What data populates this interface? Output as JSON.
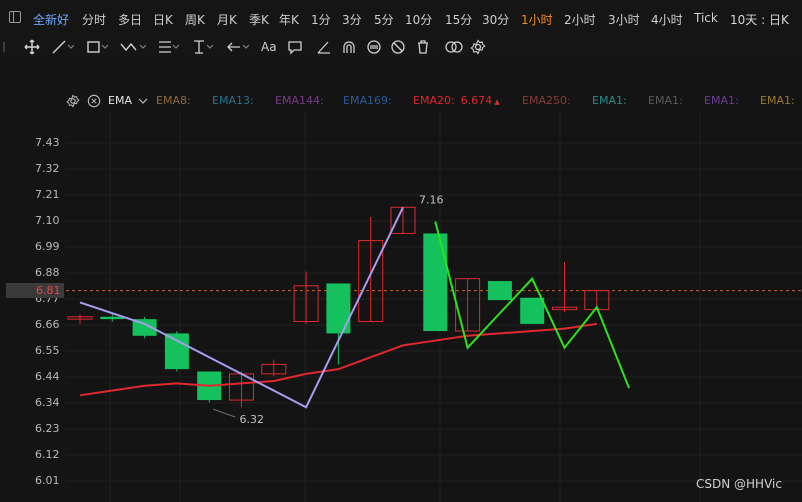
{
  "topbar": {
    "stock_name": "全新好",
    "periods": [
      {
        "label": "分时",
        "active": false
      },
      {
        "label": "多日",
        "active": false
      },
      {
        "label": "日K",
        "active": false
      },
      {
        "label": "周K",
        "active": false
      },
      {
        "label": "月K",
        "active": false
      },
      {
        "label": "季K",
        "active": false
      },
      {
        "label": "年K",
        "active": false
      },
      {
        "label": "1分",
        "active": false
      },
      {
        "label": "3分",
        "active": false
      },
      {
        "label": "5分",
        "active": false
      },
      {
        "label": "10分",
        "active": false
      },
      {
        "label": "15分",
        "active": false
      },
      {
        "label": "30分",
        "active": false
      },
      {
        "label": "1小时",
        "active": true
      },
      {
        "label": "2小时",
        "active": false
      },
      {
        "label": "3小时",
        "active": false
      },
      {
        "label": "4小时",
        "active": false
      },
      {
        "label": "Tick",
        "active": false
      }
    ],
    "range_preset": "10天 : 日K"
  },
  "toolbar": {
    "tools": [
      "move-icon",
      "line-icon",
      "rect-icon",
      "zigzag-icon",
      "hline-icon",
      "arrow-icon",
      "text-icon",
      "comment-icon",
      "pen-icon",
      "magnet-icon",
      "sync-icon",
      "hide-icon",
      "delete-icon",
      "link-icon",
      "settings-icon"
    ],
    "text_tool_label": "Aa"
  },
  "indicators": {
    "name": "EMA",
    "items": [
      {
        "label": "EMA8:",
        "color": "#8a6a3a"
      },
      {
        "label": "EMA13:",
        "color": "#2d6f8a"
      },
      {
        "label": "EMA144:",
        "color": "#7a3a8a"
      },
      {
        "label": "EMA169:",
        "color": "#2a5a9a"
      },
      {
        "label": "EMA20:",
        "color": "#e0282e",
        "value": "6.674"
      },
      {
        "label": "EMA250:",
        "color": "#8a3a3a"
      },
      {
        "label": "EMA1:",
        "color": "#2a8a8a"
      },
      {
        "label": "EMA1:",
        "color": "#5a5a5a"
      },
      {
        "label": "EMA1:",
        "color": "#6a3a9a"
      },
      {
        "label": "EMA1:",
        "color": "#9a7a2a"
      }
    ]
  },
  "y_axis": [
    "7.43",
    "7.32",
    "7.21",
    "7.10",
    "6.99",
    "6.88",
    "6.77",
    "6.66",
    "6.55",
    "6.44",
    "6.34",
    "6.23",
    "6.12",
    "6.01"
  ],
  "current_price": "6.81",
  "annotations": {
    "high": "7.16",
    "low": "6.32"
  },
  "watermark": "CSDN @HHVic",
  "colors": {
    "up": "#e0282e",
    "down": "#15c15d",
    "ema20": "#e0282e",
    "wave1": "#a99cf0",
    "wave2": "#2fe01f"
  },
  "chart_data": {
    "type": "candlestick",
    "candles": [
      {
        "o": 6.69,
        "h": 6.71,
        "l": 6.67,
        "c": 6.7
      },
      {
        "o": 6.7,
        "h": 6.71,
        "l": 6.68,
        "c": 6.69
      },
      {
        "o": 6.69,
        "h": 6.7,
        "l": 6.61,
        "c": 6.62
      },
      {
        "o": 6.63,
        "h": 6.64,
        "l": 6.47,
        "c": 6.48
      },
      {
        "o": 6.47,
        "h": 6.47,
        "l": 6.34,
        "c": 6.35
      },
      {
        "o": 6.35,
        "h": 6.47,
        "l": 6.32,
        "c": 6.46
      },
      {
        "o": 6.46,
        "h": 6.52,
        "l": 6.45,
        "c": 6.5
      },
      {
        "o": 6.68,
        "h": 6.89,
        "l": 6.67,
        "c": 6.83
      },
      {
        "o": 6.84,
        "h": 6.84,
        "l": 6.5,
        "c": 6.63
      },
      {
        "o": 6.68,
        "h": 7.12,
        "l": 6.68,
        "c": 7.02
      },
      {
        "o": 7.05,
        "h": 7.16,
        "l": 7.05,
        "c": 7.16
      },
      {
        "o": 7.05,
        "h": 7.05,
        "l": 6.64,
        "c": 6.64
      },
      {
        "o": 6.64,
        "h": 6.86,
        "l": 6.64,
        "c": 6.86
      },
      {
        "o": 6.85,
        "h": 6.85,
        "l": 6.77,
        "c": 6.77
      },
      {
        "o": 6.78,
        "h": 6.78,
        "l": 6.67,
        "c": 6.67
      },
      {
        "o": 6.73,
        "h": 6.93,
        "l": 6.72,
        "c": 6.74
      },
      {
        "o": 6.73,
        "h": 6.81,
        "l": 6.73,
        "c": 6.81
      }
    ],
    "ema20": [
      6.37,
      6.39,
      6.41,
      6.42,
      6.41,
      6.42,
      6.43,
      6.46,
      6.48,
      6.53,
      6.58,
      6.6,
      6.62,
      6.63,
      6.64,
      6.65,
      6.67
    ],
    "wave1": [
      [
        0,
        6.76
      ],
      [
        2,
        6.67
      ],
      [
        7,
        6.32
      ],
      [
        10,
        7.16
      ]
    ],
    "wave2": [
      [
        11,
        7.1
      ],
      [
        12,
        6.57
      ],
      [
        14,
        6.86
      ],
      [
        15,
        6.57
      ],
      [
        16,
        6.74
      ],
      [
        17,
        6.4
      ]
    ],
    "ylim": [
      6.01,
      7.43
    ]
  }
}
